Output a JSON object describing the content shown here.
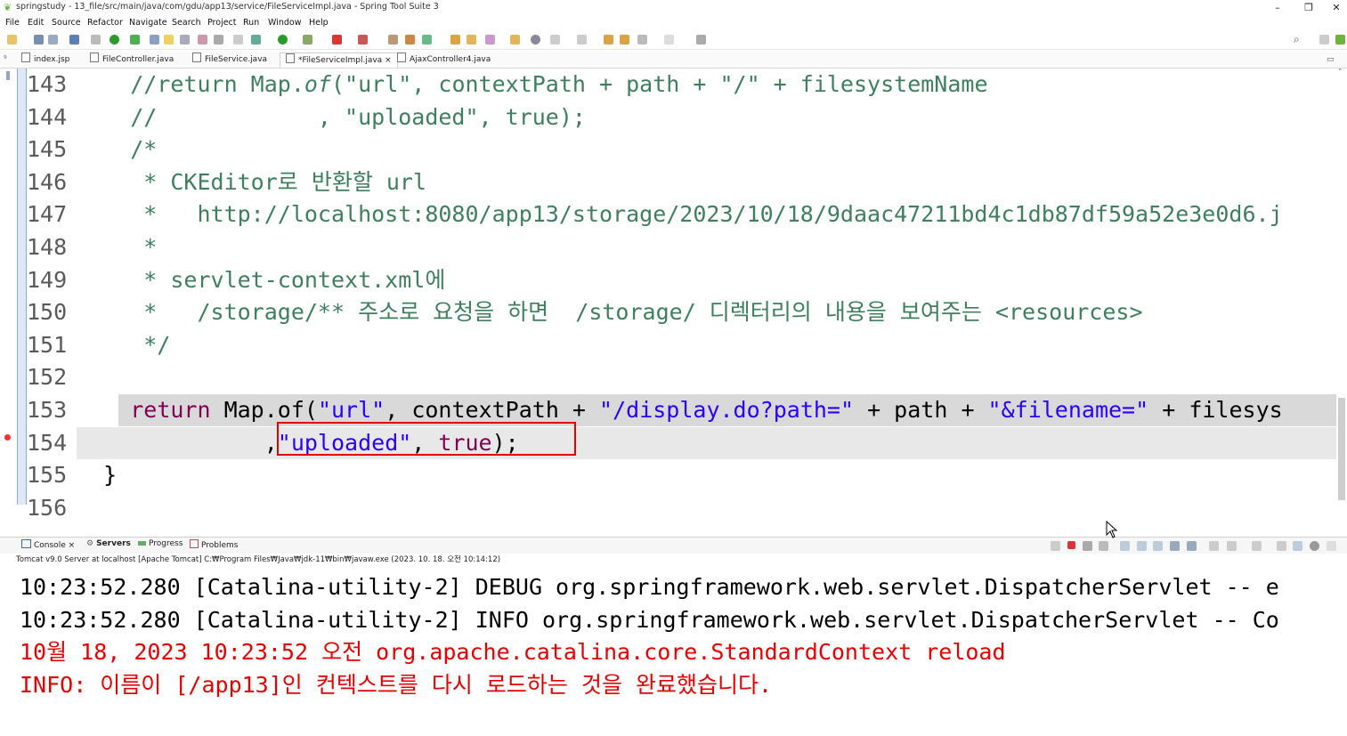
{
  "window": {
    "title": "springstudy - 13_file/src/main/java/com/gdu/app13/service/FileServiceImpl.java - Spring Tool Suite 3",
    "minimize": "–",
    "restore": "❐",
    "close": "✕"
  },
  "menu": [
    "File",
    "Edit",
    "Source",
    "Refactor",
    "Navigate",
    "Search",
    "Project",
    "Run",
    "Window",
    "Help"
  ],
  "tabs": [
    {
      "label": "index.jsp"
    },
    {
      "label": "FileController.java"
    },
    {
      "label": "FileService.java"
    },
    {
      "label": "*FileServiceImpl.java",
      "active": true,
      "close": "×"
    },
    {
      "label": "AjaxController4.java"
    }
  ],
  "editor": {
    "lines": [
      {
        "no": "143",
        "parts": [
          {
            "t": "    //return Map.",
            "c": "cmt"
          },
          {
            "t": "of",
            "c": "cmt"
          },
          {
            "t": "(\"url\", contextPath + path + \"/\" + filesystemName",
            "c": "cmt"
          }
        ]
      },
      {
        "no": "144",
        "parts": [
          {
            "t": "    //            , \"uploaded\", true);",
            "c": "cmt"
          }
        ]
      },
      {
        "no": "145",
        "parts": [
          {
            "t": "    /*",
            "c": "cmt"
          }
        ]
      },
      {
        "no": "146",
        "parts": [
          {
            "t": "     * CKEditor로 반환할 url",
            "c": "cmt"
          }
        ]
      },
      {
        "no": "147",
        "parts": [
          {
            "t": "     *   http://localhost:8080/app13/storage/2023/10/18/9daac47211bd4c1db87df59a52e3e0d6.j",
            "c": "cmt"
          }
        ]
      },
      {
        "no": "148",
        "parts": [
          {
            "t": "     *",
            "c": "cmt"
          }
        ]
      },
      {
        "no": "149",
        "parts": [
          {
            "t": "     * servlet-context.xml에",
            "c": "cmt"
          }
        ]
      },
      {
        "no": "150",
        "parts": [
          {
            "t": "     *   /storage/** 주소로 요청을 하면  /storage/ 디렉터리의 내용을 보여주는 <resources>",
            "c": "cmt"
          }
        ]
      },
      {
        "no": "151",
        "parts": [
          {
            "t": "     */",
            "c": "cmt"
          }
        ]
      },
      {
        "no": "152",
        "parts": []
      },
      {
        "no": "153",
        "parts": [
          {
            "t": "    ",
            "c": ""
          },
          {
            "t": "return",
            "c": "kw"
          },
          {
            "t": " Map.of(",
            "c": ""
          },
          {
            "t": "\"url\"",
            "c": "str"
          },
          {
            "t": ", contextPath + ",
            "c": ""
          },
          {
            "t": "\"/display.do?path=\"",
            "c": "str"
          },
          {
            "t": " + path + ",
            "c": ""
          },
          {
            "t": "\"&filename=\"",
            "c": "str"
          },
          {
            "t": " + filesys",
            "c": ""
          }
        ]
      },
      {
        "no": "154",
        "parts": [
          {
            "t": "              ,",
            "c": ""
          },
          {
            "t": "\"uploaded\"",
            "c": "str"
          },
          {
            "t": ", ",
            "c": ""
          },
          {
            "t": "true",
            "c": "kw"
          },
          {
            "t": ");",
            "c": ""
          }
        ]
      },
      {
        "no": "155",
        "parts": [
          {
            "t": "  }",
            "c": ""
          }
        ]
      },
      {
        "no": "156",
        "parts": []
      }
    ]
  },
  "console": {
    "tabs": [
      "Console",
      "Servers",
      "Progress",
      "Problems"
    ],
    "close": "×",
    "description": "Tomcat v9.0 Server at localhost [Apache Tomcat] C:₩Program Files₩Java₩jdk-11₩bin₩javaw.exe  (2023. 10. 18. 오전 10:14:12)",
    "lines": [
      {
        "text": "10:23:52.280 [Catalina-utility-2] DEBUG org.springframework.web.servlet.DispatcherServlet -- e",
        "kind": "info"
      },
      {
        "text": "10:23:52.280 [Catalina-utility-2] INFO org.springframework.web.servlet.DispatcherServlet -- Co",
        "kind": "info"
      },
      {
        "text": "10월 18, 2023 10:23:52 오전 org.apache.catalina.core.StandardContext reload",
        "kind": "err"
      },
      {
        "text": "INFO: 이름이 [/app13]인 컨텍스트를 다시 로드하는 것을 완료했습니다.",
        "kind": "err"
      }
    ]
  },
  "colors": {
    "comment": "#3f7f5f",
    "keyword": "#7f0055",
    "string": "#2a00ff",
    "error": "#e40000",
    "highlight_box": "#e00000"
  }
}
